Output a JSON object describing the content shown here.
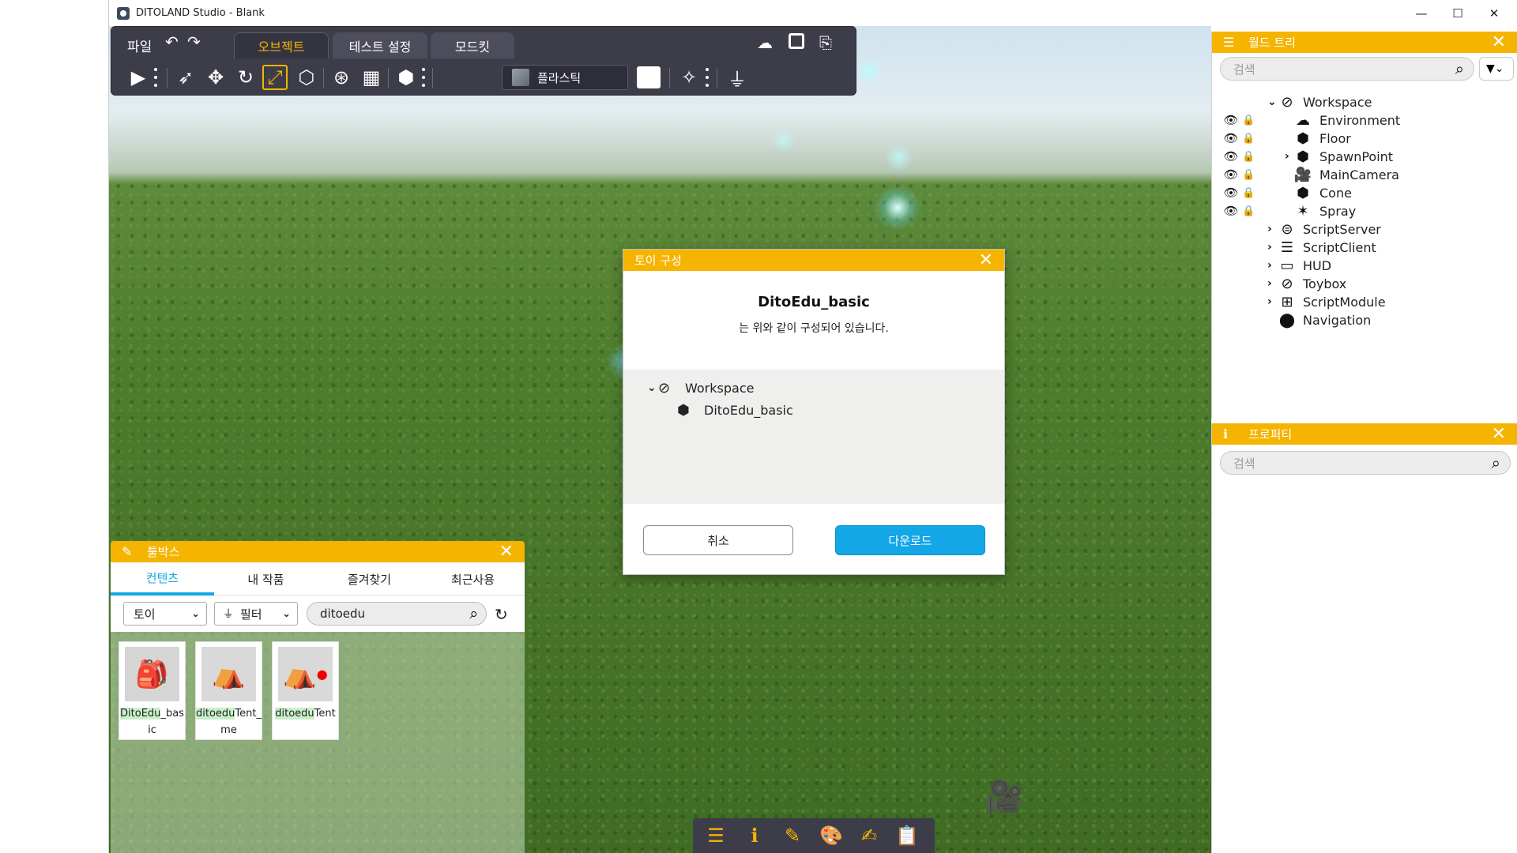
{
  "window": {
    "title": "DITOLAND Studio - Blank",
    "controls": {
      "minimize": "—",
      "maximize": "☐",
      "close": "✕"
    }
  },
  "menu": {
    "file": "파일",
    "tabs": [
      {
        "label": "오브젝트",
        "active": true
      },
      {
        "label": "테스트 설정",
        "active": false
      },
      {
        "label": "모드킷",
        "active": false
      }
    ]
  },
  "toolbar": {
    "material": "플라스틱",
    "selected_tool": "scale"
  },
  "world_tree": {
    "title": "월드 트리",
    "search_placeholder": "검색",
    "items": [
      {
        "label": "Workspace",
        "icon": "workspace-icon",
        "expanded": true
      },
      {
        "label": "Environment",
        "icon": "environment-icon"
      },
      {
        "label": "Floor",
        "icon": "part-icon",
        "locked": true
      },
      {
        "label": "SpawnPoint",
        "icon": "part-icon",
        "collapsed": true
      },
      {
        "label": "MainCamera",
        "icon": "camera-icon"
      },
      {
        "label": "Cone",
        "icon": "part-icon"
      },
      {
        "label": "Spray",
        "icon": "spray-icon"
      },
      {
        "label": "ScriptServer",
        "icon": "script-server-icon"
      },
      {
        "label": "ScriptClient",
        "icon": "script-client-icon"
      },
      {
        "label": "HUD",
        "icon": "hud-icon"
      },
      {
        "label": "Toybox",
        "icon": "toybox-icon"
      },
      {
        "label": "ScriptModule",
        "icon": "script-module-icon"
      },
      {
        "label": "Navigation",
        "icon": "navigation-icon"
      }
    ]
  },
  "properties": {
    "title": "프로퍼티",
    "search_placeholder": "검색"
  },
  "dialog": {
    "title": "토이 구성",
    "heading": "DitoEdu_basic",
    "subtitle": "는 위와 같이 구성되어 있습니다.",
    "tree": [
      {
        "label": "Workspace",
        "icon": "workspace-icon"
      },
      {
        "label": "DitoEdu_basic",
        "icon": "part-icon"
      }
    ],
    "cancel": "취소",
    "download": "다운로드"
  },
  "toolbox": {
    "title": "툴박스",
    "tabs": [
      {
        "label": "컨텐츠",
        "active": true
      },
      {
        "label": "내 작품",
        "active": false
      },
      {
        "label": "즐겨찾기",
        "active": false
      },
      {
        "label": "최근사용",
        "active": false
      }
    ],
    "category": "토이",
    "filter": "필터",
    "search_value": "ditoedu",
    "items": [
      {
        "name_hl": "DitoEdu",
        "name_rest": "_basic"
      },
      {
        "name_hl": "ditoedu",
        "name_rest": "Tent_me"
      },
      {
        "name_hl": "ditoedu",
        "name_rest": "Tent"
      }
    ]
  },
  "colors": {
    "accent": "#f5b400",
    "toolbar_bg": "#3d3d4a",
    "primary_button": "#13a7e8"
  }
}
